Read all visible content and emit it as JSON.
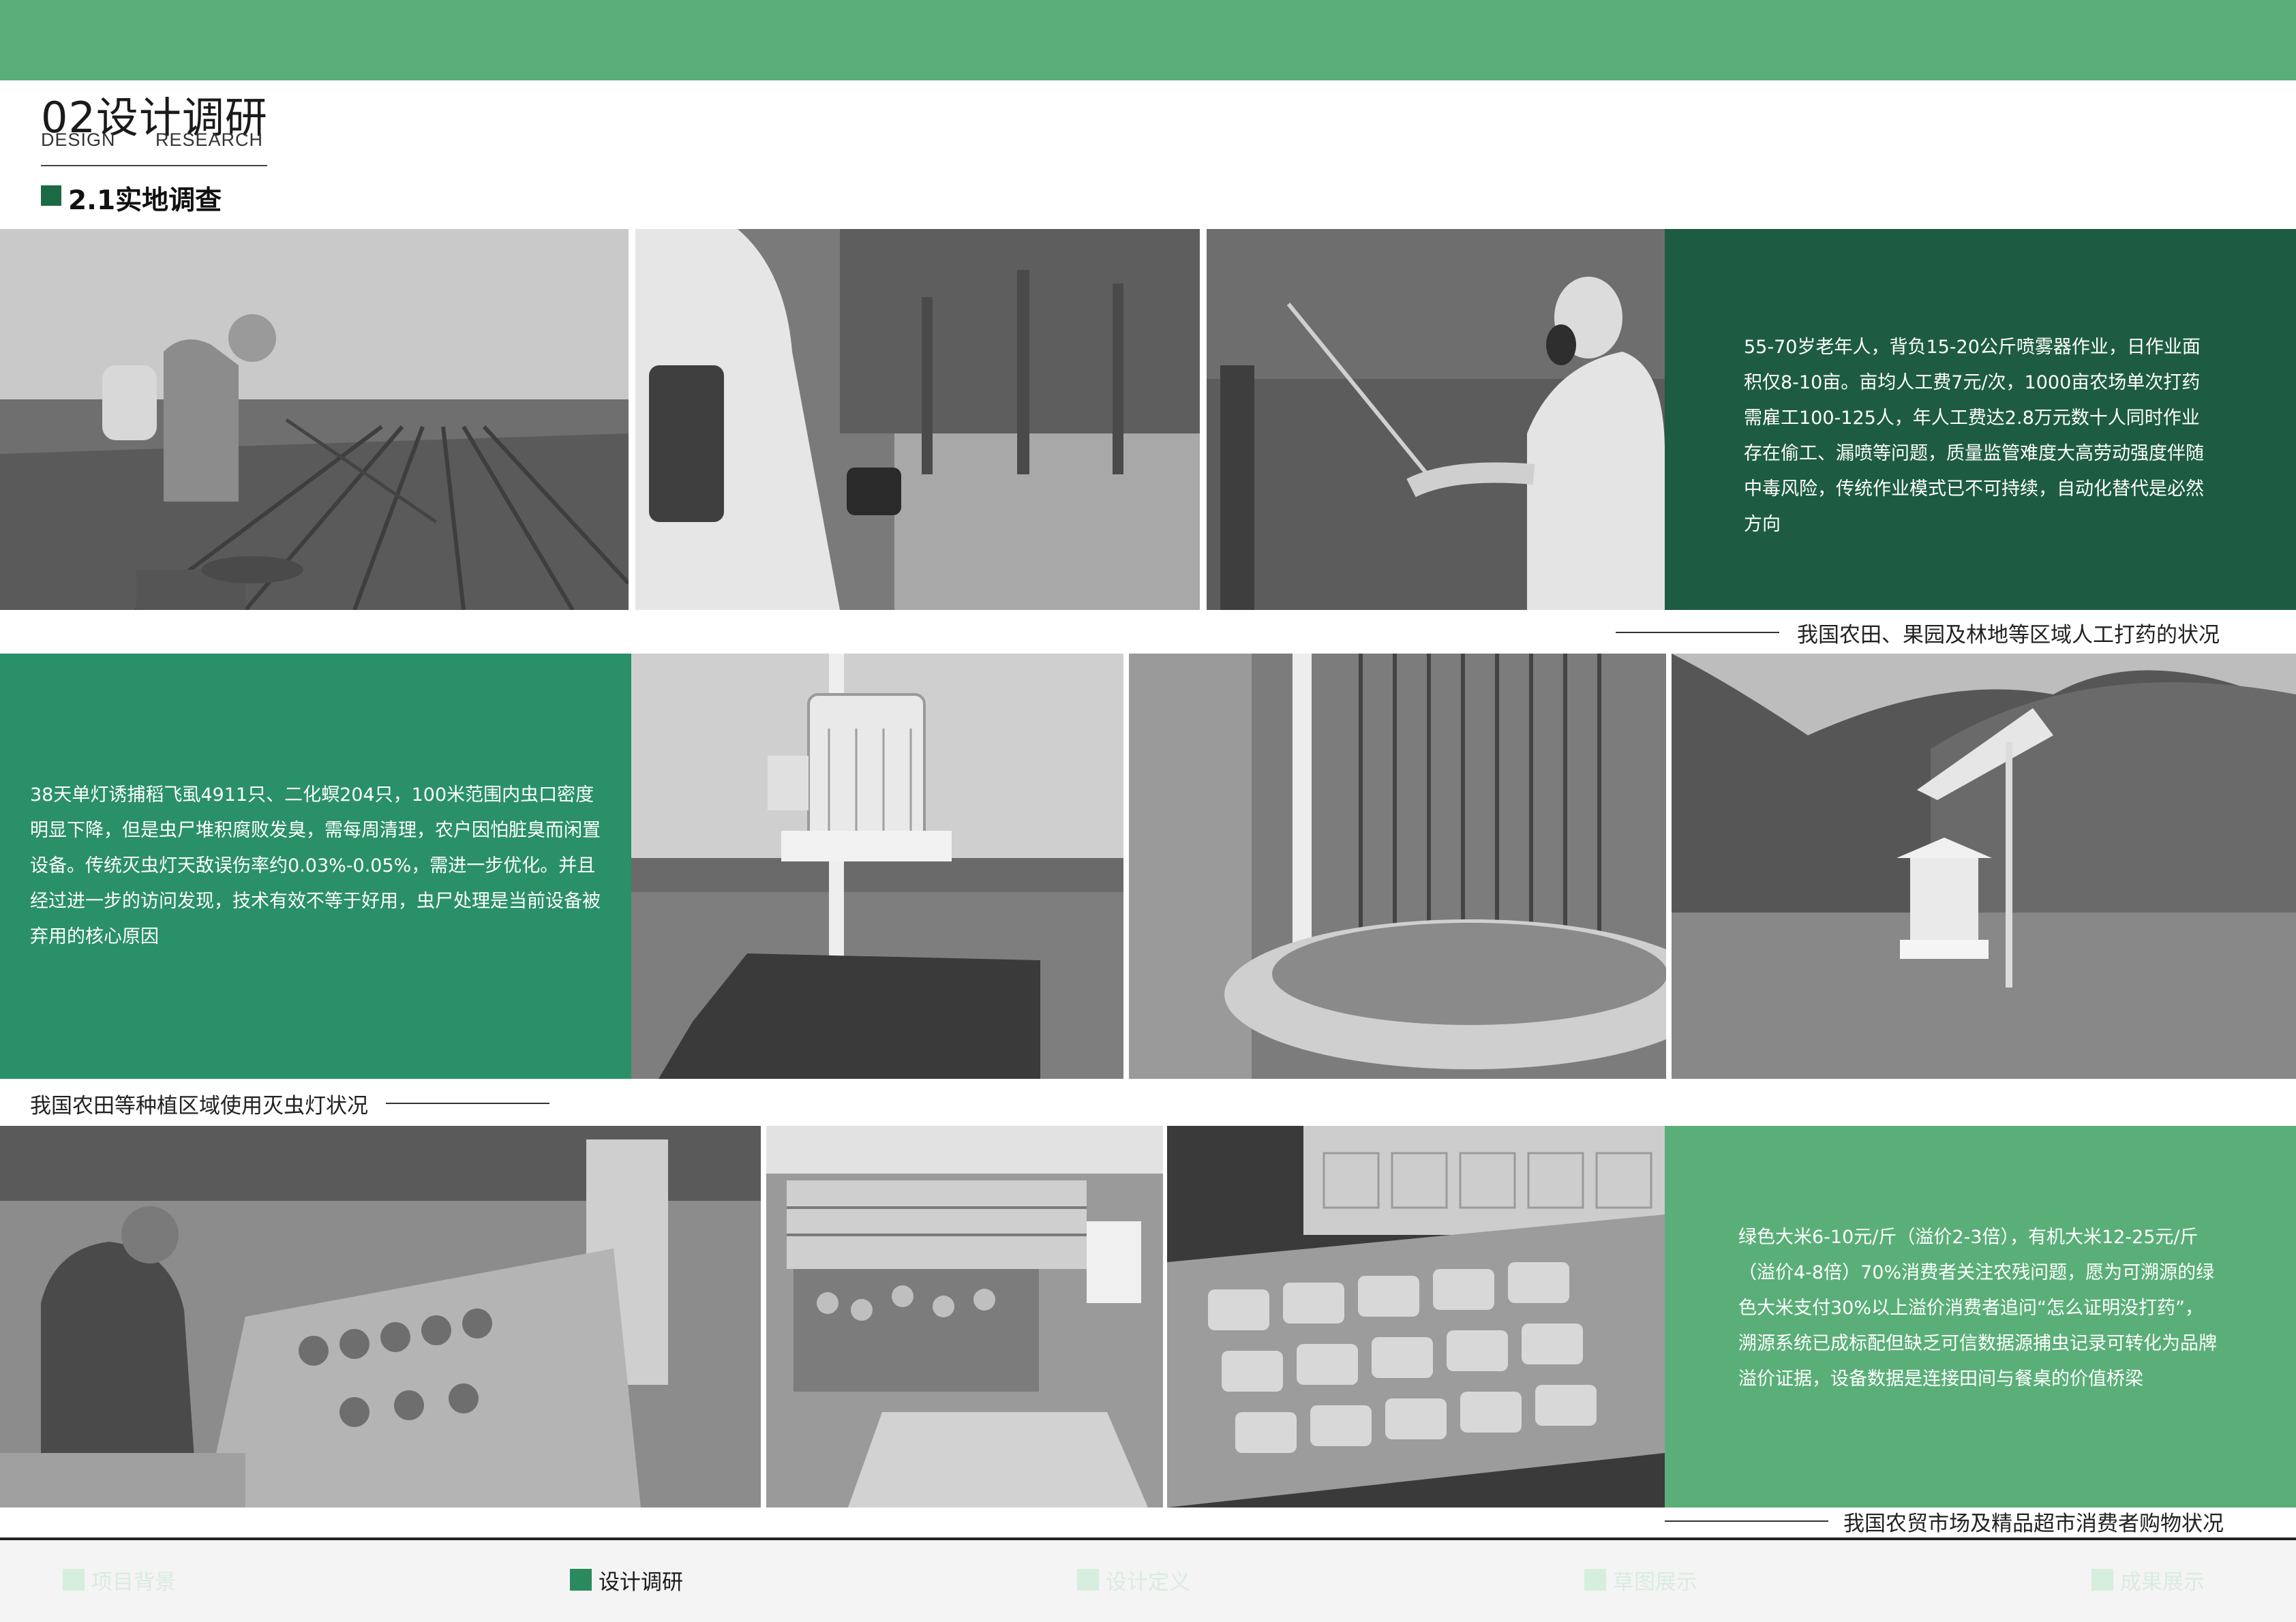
{
  "header": {
    "title": "02设计调研",
    "subtitle_en_1": "DESIGN",
    "subtitle_en_2": "RESEARCH",
    "section_label": "2.1实地调查"
  },
  "rows": [
    {
      "text": "55-70岁老年人，背负15-20公斤喷雾器作业，日作业面积仅8-10亩。亩均人工费7元/次，1000亩农场单次打药需雇工100-125人，年人工费达2.8万元数十人同时作业存在偷工、漏喷等问题，质量监管难度大高劳动强度伴随中毒风险，传统作业模式已不可持续，自动化替代是必然方向",
      "caption": "我国农田、果园及林地等区域人工打药的状况",
      "bg": "#1d5c40"
    },
    {
      "text": "38天单灯诱捕稻飞虱4911只、二化螟204只，100米范围内虫口密度明显下降，但是虫尸堆积腐败发臭，需每周清理，农户因怕脏臭而闲置设备。传统灭虫灯天敌误伤率约0.03%-0.05%，需进一步优化。并且经过进一步的访问发现，技术有效不等于好用，虫尸处理是当前设备被弃用的核心原因",
      "caption": "我国农田等种植区域使用灭虫灯状况",
      "bg": "#2a9068"
    },
    {
      "text": "绿色大米6-10元/斤（溢价2-3倍），有机大米12-25元/斤（溢价4-8倍）70%消费者关注农残问题，愿为可溯源的绿色大米支付30%以上溢价消费者追问“怎么证明没打药”，溯源系统已成标配但缺乏可信数据源捕虫记录可转化为品牌溢价证据，设备数据是连接田间与餐桌的价值桥梁",
      "caption": "我国农贸市场及精品超市消费者购物状况",
      "bg": "#5aaf78"
    }
  ],
  "nav": [
    {
      "label": "项目背景",
      "active": false
    },
    {
      "label": "设计调研",
      "active": true
    },
    {
      "label": "设计定义",
      "active": false
    },
    {
      "label": "草图展示",
      "active": false
    },
    {
      "label": "成果展示",
      "active": false
    }
  ],
  "colors": {
    "top_bar": "#5aaf78",
    "dark_green": "#1d5c40",
    "mid_green": "#2a9068",
    "light_green": "#5aaf78",
    "nav_active": "#2a8a5e",
    "nav_inactive": "#d6eedd"
  },
  "photos": [
    "farmer-spraying-field-photo",
    "worker-spraying-orchard-photo",
    "protective-suit-spraying-photo",
    "insect-lamp-field-photo",
    "insect-lamp-closeup-photo",
    "solar-insect-lamp-photo",
    "farmers-market-photo",
    "supermarket-produce-photo",
    "packaged-fruit-shelf-photo"
  ]
}
